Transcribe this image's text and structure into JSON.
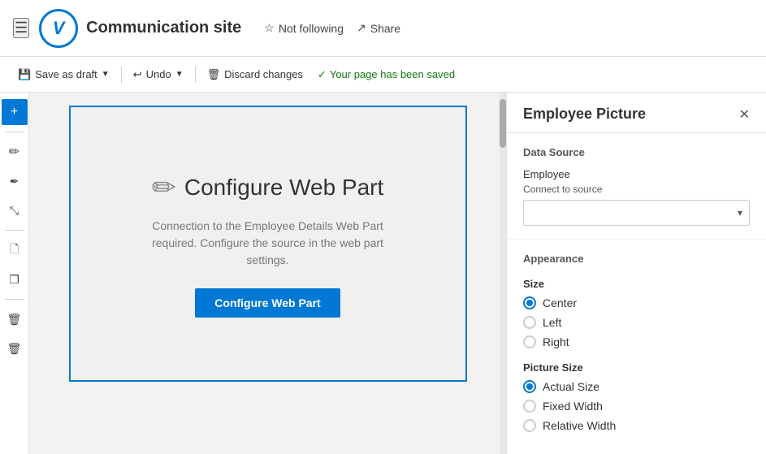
{
  "topNav": {
    "hamburger": "☰",
    "logoText": "V",
    "siteTitle": "Communication site",
    "notFollowingLabel": "Not following",
    "shareLabel": "Share"
  },
  "toolbar": {
    "saveAsDraftLabel": "Save as draft",
    "undoLabel": "Undo",
    "discardChangesLabel": "Discard changes",
    "savedMessage": "Your page has been saved"
  },
  "sidebarIcons": [
    {
      "name": "add",
      "symbol": "+",
      "add": true
    },
    {
      "name": "edit",
      "symbol": "✏"
    },
    {
      "name": "pencil",
      "symbol": "✒"
    },
    {
      "name": "move",
      "symbol": "⤢"
    },
    {
      "name": "page",
      "symbol": "🗋"
    },
    {
      "name": "copy",
      "symbol": "❐"
    },
    {
      "name": "delete",
      "symbol": "🗑"
    },
    {
      "name": "delete2",
      "symbol": "🗑"
    }
  ],
  "webPart": {
    "iconSymbol": "✏",
    "title": "Configure Web Part",
    "description": "Connection to the Employee Details Web Part required. Configure the source in the web part settings.",
    "buttonLabel": "Configure Web Part"
  },
  "rightPanel": {
    "title": "Employee Picture",
    "closeSymbol": "✕",
    "dataSourceLabel": "Data Source",
    "employeeLabel": "Employee",
    "connectToSourceLabel": "Connect to source",
    "connectPlaceholder": "",
    "appearanceLabel": "Appearance",
    "sizeLabel": "Size",
    "sizeOptions": [
      {
        "label": "Center",
        "selected": true
      },
      {
        "label": "Left",
        "selected": false
      },
      {
        "label": "Right",
        "selected": false
      }
    ],
    "pictureSizeLabel": "Picture Size",
    "pictureSizeOptions": [
      {
        "label": "Actual Size",
        "selected": true
      },
      {
        "label": "Fixed Width",
        "selected": false
      },
      {
        "label": "Relative Width",
        "selected": false
      }
    ]
  },
  "colors": {
    "accent": "#0078d4",
    "savedGreen": "#107c10"
  }
}
